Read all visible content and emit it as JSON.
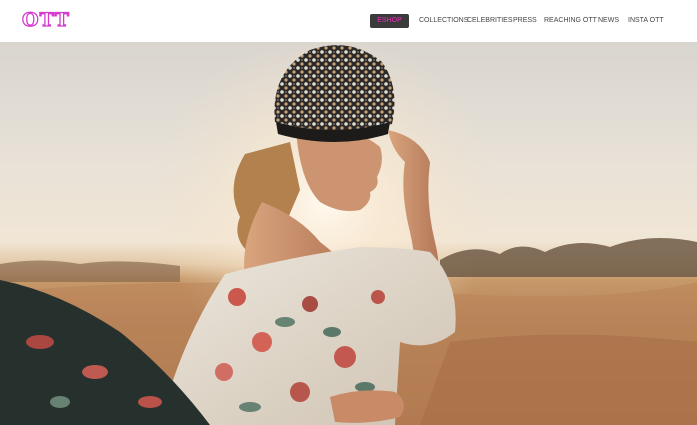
{
  "logo": {
    "letters": [
      "O",
      "T",
      "T"
    ],
    "color": "#d63bd0"
  },
  "nav": {
    "items": [
      {
        "label": "ESHOP",
        "active": true
      },
      {
        "label": "COLLECTIONS",
        "active": false
      },
      {
        "label": "CELEBRITIES",
        "active": false
      },
      {
        "label": "PRESS",
        "active": false
      },
      {
        "label": "REACHING OTT",
        "active": false
      },
      {
        "label": "NEWS",
        "active": false
      },
      {
        "label": "INSTA OTT",
        "active": false
      }
    ]
  },
  "hero": {
    "image": "woman-in-sequin-turban-desert-sunset-photo"
  },
  "colors": {
    "accent": "#f12bc3",
    "nav_active_bg": "#3b3b3b",
    "nav_text": "#444444"
  }
}
